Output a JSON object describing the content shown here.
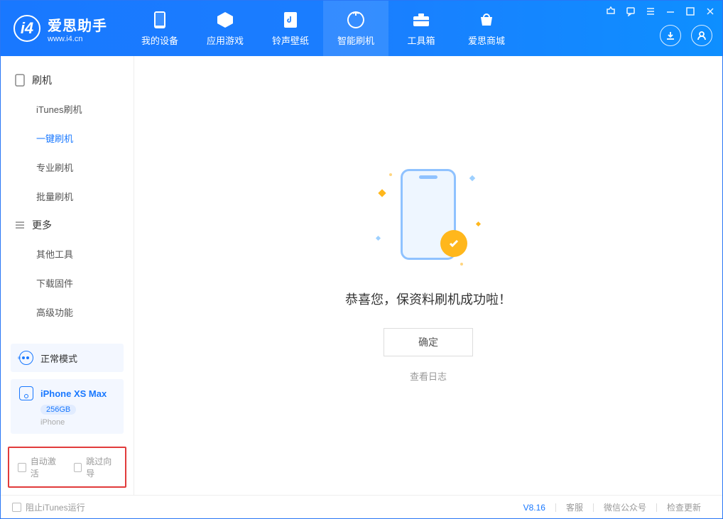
{
  "logo": {
    "title": "爱思助手",
    "subtitle": "www.i4.cn"
  },
  "nav": {
    "device": "我的设备",
    "apps": "应用游戏",
    "ring": "铃声壁纸",
    "flash": "智能刷机",
    "tools": "工具箱",
    "store": "爱思商城"
  },
  "sidebar": {
    "group_flash": "刷机",
    "itunes": "iTunes刷机",
    "oneclick": "一键刷机",
    "pro": "专业刷机",
    "batch": "批量刷机",
    "group_more": "更多",
    "other": "其他工具",
    "firmware": "下载固件",
    "advanced": "高级功能"
  },
  "devicePanel": {
    "mode": "正常模式",
    "name": "iPhone XS Max",
    "capacity": "256GB",
    "type": "iPhone"
  },
  "options": {
    "auto_activate": "自动激活",
    "skip_guide": "跳过向导"
  },
  "main": {
    "success": "恭喜您，保资料刷机成功啦！",
    "ok": "确定",
    "log": "查看日志"
  },
  "footer": {
    "block_itunes": "阻止iTunes运行",
    "version": "V8.16",
    "support": "客服",
    "wechat": "微信公众号",
    "update": "检查更新"
  }
}
